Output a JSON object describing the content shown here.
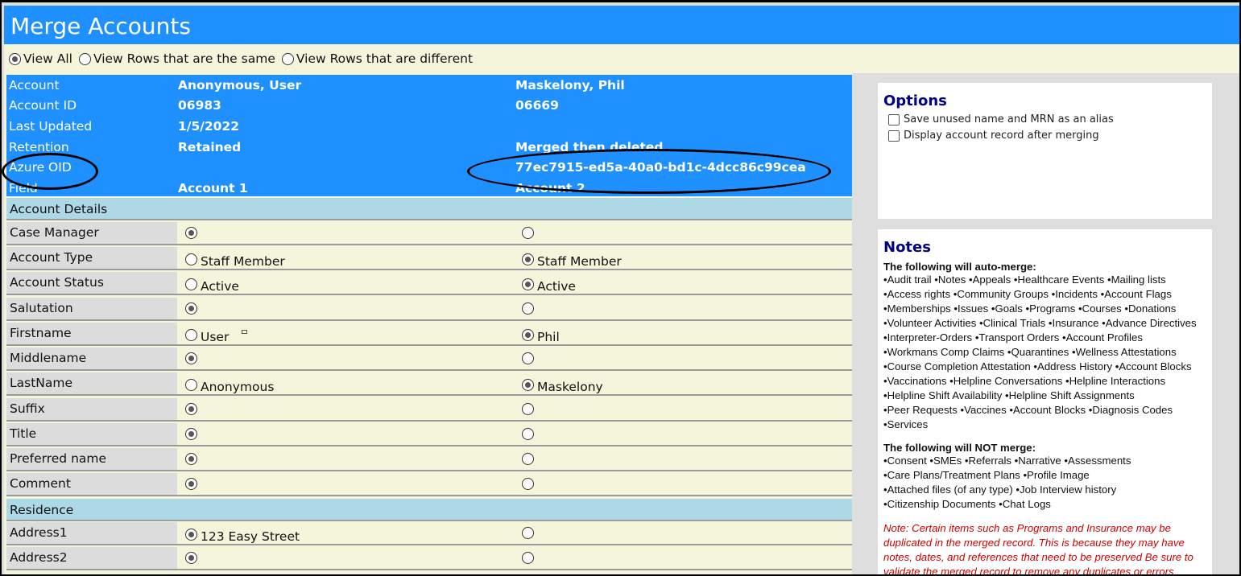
{
  "page": {
    "title": "Merge Accounts"
  },
  "view_options": {
    "selected": 0,
    "items": [
      {
        "label": "View All"
      },
      {
        "label": "View Rows that are the same"
      },
      {
        "label": "View Rows that are different"
      }
    ]
  },
  "header": {
    "rows": [
      {
        "label": "Account",
        "a1": "Anonymous, User",
        "a2": "Maskelony, Phil"
      },
      {
        "label": "Account ID",
        "a1": "06983",
        "a2": "06669"
      },
      {
        "label": "Last Updated",
        "a1": "1/5/2022",
        "a2": ""
      },
      {
        "label": "Retention",
        "a1": "Retained",
        "a2": "Merged then deleted"
      },
      {
        "label": "Azure OID",
        "a1": "",
        "a2": "77ec7915-ed5a-40a0-bd1c-4dcc86c99cea"
      },
      {
        "label": "Field",
        "a1": "Account 1",
        "a2": "Account 2"
      }
    ]
  },
  "sections": {
    "account_details": "Account Details",
    "residence": "Residence"
  },
  "fields": {
    "case_manager": {
      "label": "Case Manager",
      "v1": "",
      "v2": "",
      "sel": 1
    },
    "account_type": {
      "label": "Account Type",
      "v1": "Staff Member",
      "v2": "Staff Member",
      "sel": 2
    },
    "account_status": {
      "label": "Account Status",
      "v1": "Active",
      "v2": "Active",
      "sel": 2
    },
    "salutation": {
      "label": "Salutation",
      "v1": "",
      "v2": "",
      "sel": 1
    },
    "firstname": {
      "label": "Firstname",
      "v1": "User",
      "v2": "Phil",
      "sel": 2
    },
    "middlename": {
      "label": "Middlename",
      "v1": "",
      "v2": "",
      "sel": 1
    },
    "lastname": {
      "label": "LastName",
      "v1": "Anonymous",
      "v2": "Maskelony",
      "sel": 2
    },
    "suffix": {
      "label": "Suffix",
      "v1": "",
      "v2": "",
      "sel": 1
    },
    "title": {
      "label": "Title",
      "v1": "",
      "v2": "",
      "sel": 1
    },
    "preferred_name": {
      "label": "Preferred name",
      "v1": "",
      "v2": "",
      "sel": 1
    },
    "comment": {
      "label": "Comment",
      "v1": "",
      "v2": "",
      "sel": 1
    },
    "address1": {
      "label": "Address1",
      "v1": "123 Easy Street",
      "v2": "",
      "sel": 1
    },
    "address2": {
      "label": "Address2",
      "v1": "",
      "v2": "",
      "sel": 1
    }
  },
  "options": {
    "title": "Options",
    "items": [
      {
        "label": "Save unused name and MRN as an alias",
        "checked": false
      },
      {
        "label": "Display account record after merging",
        "checked": false
      }
    ]
  },
  "notes": {
    "title": "Notes",
    "auto_heading": "The following will auto-merge:",
    "auto_lines": [
      "•Audit trail •Notes •Appeals •Healthcare Events •Mailing lists",
      "•Access rights •Community Groups •Incidents •Account Flags",
      "•Memberships •Issues •Goals •Programs •Courses •Donations",
      "•Volunteer Activities •Clinical Trials •Insurance •Advance Directives",
      "•Interpreter-Orders •Transport Orders •Account Profiles",
      "•Workmans Comp Claims •Quarantines •Wellness Attestations",
      "•Course Completion Attestation •Address History •Account Blocks",
      "•Vaccinations •Helpline Conversations •Helpline Interactions",
      "•Helpline Shift Availability •Helpline Shift Assignments",
      "•Peer Requests •Vaccines •Account Blocks •Diagnosis Codes",
      "•Services"
    ],
    "not_heading": "The following will NOT merge:",
    "not_lines": [
      "•Consent •SMEs •Referrals •Narrative •Assessments",
      "•Care Plans/Treatment Plans •Profile Image",
      "•Attached files (of any type) •Job Interview history",
      "•Citizenship Documents •Chat Logs"
    ],
    "disclaimer": "Note: Certain items such as Programs and Insurance may be duplicated in the merged record. This is because they may have notes, dates, and references that need to be preserved Be sure to validate the merged record to remove any duplicates or errors"
  }
}
